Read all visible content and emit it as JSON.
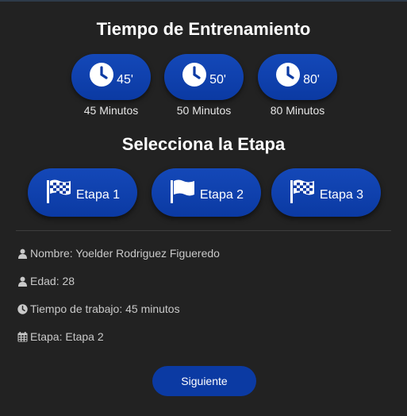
{
  "training": {
    "title": "Tiempo de Entrenamiento",
    "options": [
      {
        "value": "45'",
        "caption": "45 Minutos",
        "icon": "clock-icon"
      },
      {
        "value": "50'",
        "caption": "50 Minutos",
        "icon": "clock-icon"
      },
      {
        "value": "80'",
        "caption": "80 Minutos",
        "icon": "clock-icon"
      }
    ]
  },
  "stage": {
    "title": "Selecciona la Etapa",
    "options": [
      {
        "label": "Etapa 1",
        "icon": "checkered-flag-icon"
      },
      {
        "label": "Etapa 2",
        "icon": "flag-icon"
      },
      {
        "label": "Etapa 3",
        "icon": "checkered-flag-icon"
      }
    ]
  },
  "info": {
    "name": "Nombre: Yoelder Rodriguez Figueredo",
    "age": "Edad: 28",
    "work_time": "Tiempo de trabajo: 45 minutos",
    "stage": "Etapa: Etapa 2"
  },
  "next_label": "Siguiente",
  "colors": {
    "background": "#222222",
    "button": "#0b3aa3",
    "text": "#ffffff",
    "muted_text": "#c9c9c9"
  }
}
